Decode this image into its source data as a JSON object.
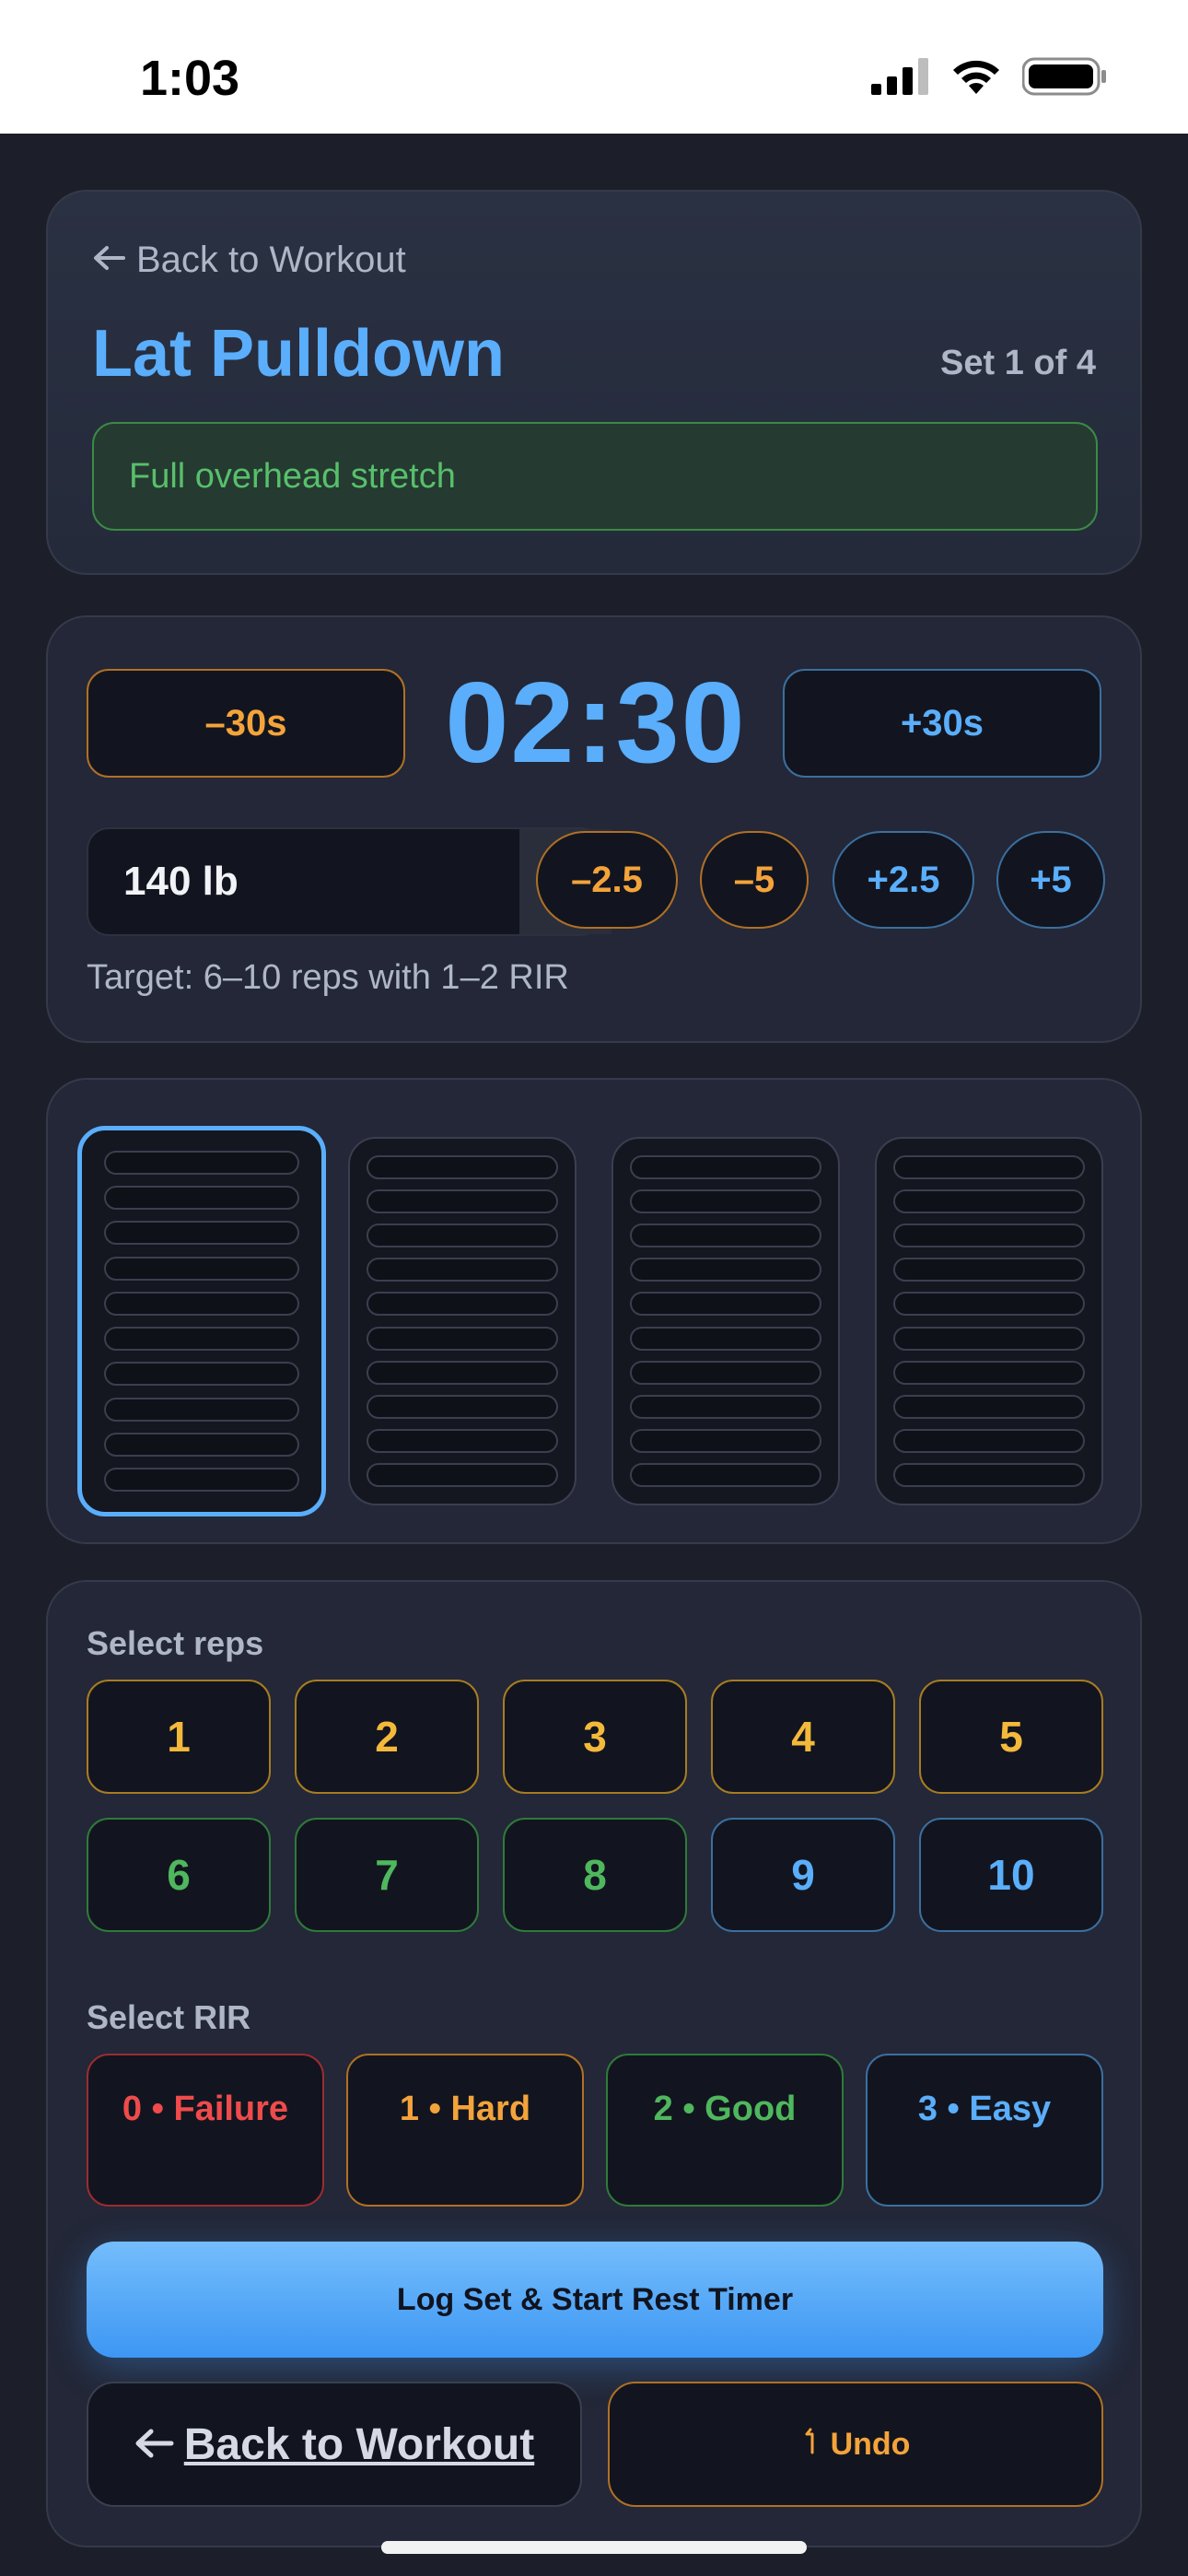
{
  "status": {
    "time": "1:03"
  },
  "header": {
    "back_label": "Back to Workout",
    "exercise": "Lat Pulldown",
    "set_label": "Set 1 of 4",
    "cue": "Full overhead stretch"
  },
  "timer": {
    "minus_label": "–30s",
    "display": "02:30",
    "plus_label": "+30s",
    "weight": "140 lb",
    "adjust": [
      "–2.5",
      "–5",
      "+2.5",
      "+5"
    ],
    "target": "Target: 6–10 reps with 1–2 RIR"
  },
  "sets": {
    "count": 4,
    "active_index": 0
  },
  "reps": {
    "label": "Select reps",
    "options": [
      "1",
      "2",
      "3",
      "4",
      "5",
      "6",
      "7",
      "8",
      "9",
      "10"
    ]
  },
  "rir": {
    "label": "Select RIR",
    "options": [
      "0 • Failure",
      "1 • Hard",
      "2 • Good",
      "3 • Easy"
    ]
  },
  "actions": {
    "log_label": "Log Set & Start Rest Timer",
    "back_label": "Back to Workout",
    "undo_label": "Undo"
  },
  "colors": {
    "accent_blue": "#5aaefb",
    "orange": "#f4a33b",
    "yellow": "#f4b93b",
    "green": "#4fb75d",
    "red": "#ef4b4b",
    "background": "#1c1f2a"
  }
}
